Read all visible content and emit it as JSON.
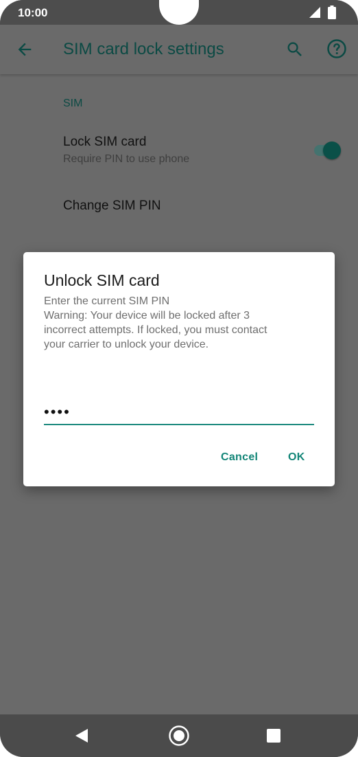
{
  "status_bar": {
    "time": "10:00",
    "signal_icon": "signal-icon",
    "battery_icon": "battery-icon"
  },
  "app_bar": {
    "title": "SIM card lock settings",
    "back_icon": "arrow-back-icon",
    "search_icon": "search-icon",
    "help_icon": "help-icon"
  },
  "settings": {
    "section_header": "SIM",
    "lock_sim": {
      "title": "Lock SIM card",
      "summary": "Require PIN to use phone",
      "enabled": true
    },
    "change_pin": {
      "title": "Change SIM PIN"
    }
  },
  "dialog": {
    "title": "Unlock SIM card",
    "message_lines": [
      "Enter the current SIM PIN",
      "Warning: Your device will be locked after 3",
      "incorrect attempts. If locked, you must contact",
      "your carrier to unlock your device."
    ],
    "pin_value": "••••",
    "cancel_label": "Cancel",
    "ok_label": "OK"
  },
  "nav_bar": {
    "back_icon": "nav-back-icon",
    "home_icon": "nav-home-icon",
    "recents_icon": "nav-recents-icon"
  },
  "colors": {
    "accent": "#128577",
    "app_title": "#0b4a44",
    "scrim_background": "#6a6a6a"
  }
}
